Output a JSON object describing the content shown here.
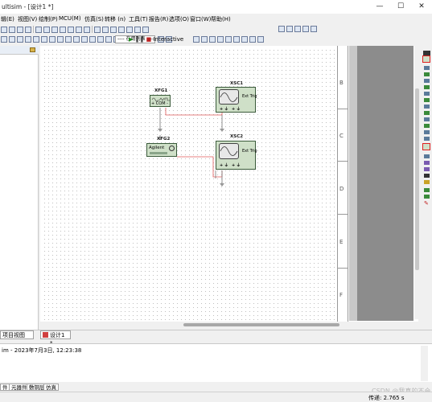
{
  "window": {
    "title": "ultisim - [设计1 *]",
    "controls": [
      "—",
      "☐",
      "✕"
    ]
  },
  "menu": [
    "辑(E)",
    "视图(V)",
    "绘制(P)",
    "MCU(M)",
    "仿真(S)",
    "转移 (n)",
    "工具(T)",
    "报告(R)",
    "选项(O)",
    "窗口(W)",
    "帮助(H)"
  ],
  "toolbar": {
    "in_use_list": "---- 在用列表 ----",
    "interactive": "Interactive"
  },
  "row_labels": [
    "B",
    "C",
    "D",
    "E",
    "F"
  ],
  "instruments": {
    "xfg1": {
      "name": "XFG1",
      "pins": "+  COM  -"
    },
    "xfg2": {
      "name": "XFG2",
      "brand": "Agilent"
    },
    "xsc1": {
      "name": "XSC1",
      "ext_trig": "Ext Trig"
    },
    "xsc2": {
      "name": "XSC2",
      "ext_trig": "Ext Trig"
    }
  },
  "panel_tabs": {
    "project_view": "项目视图",
    "design_tab": "设计1 *"
  },
  "log": {
    "entry": "im  -  2023年7月3日, 12:23:38"
  },
  "bottom_tabs": [
    "件",
    "元器件",
    "敷铜层",
    "仿真"
  ],
  "status": {
    "transfer": "传递: 2.765 s",
    "watermark": "CSDN @我真的不会"
  }
}
